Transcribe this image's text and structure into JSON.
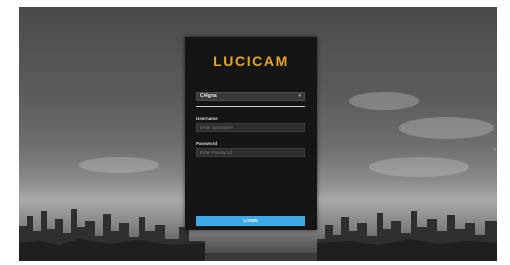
{
  "brand": {
    "logo_text": "LUCICAM",
    "accent_color": "#e5a622"
  },
  "login_form": {
    "site_select": {
      "value": "Ci4gna",
      "icon": "chevron-down-icon"
    },
    "username": {
      "label": "Username",
      "placeholder": "Enter Username",
      "value": ""
    },
    "password": {
      "label": "Password",
      "placeholder": "Enter Password",
      "value": "",
      "icon": "eye-icon"
    },
    "login_button": {
      "label": "LOGIN",
      "color": "#3fa9e6"
    }
  }
}
